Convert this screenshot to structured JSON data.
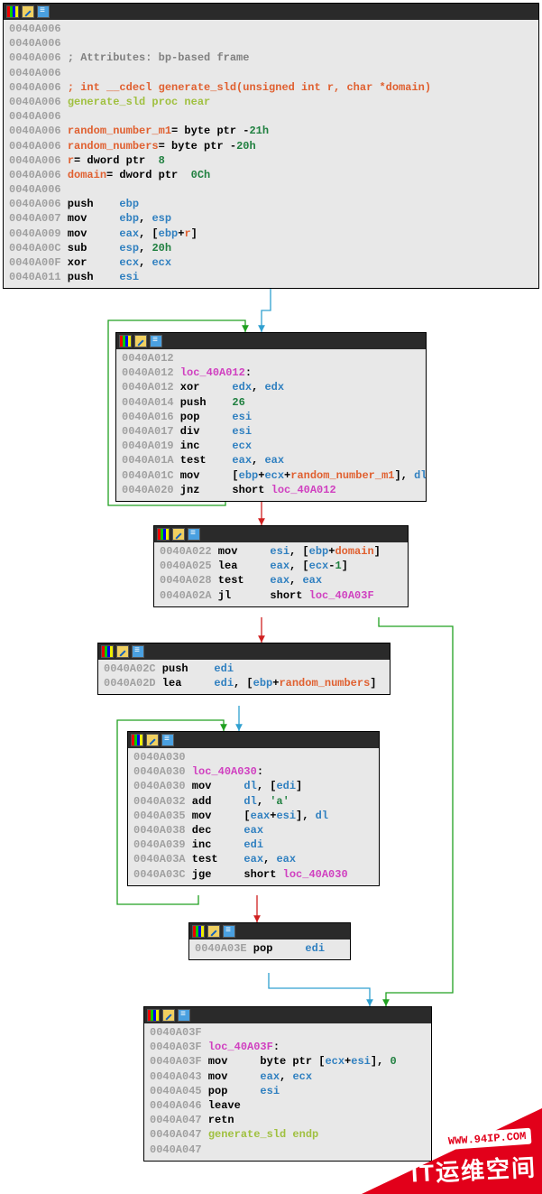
{
  "watermark": {
    "url": "WWW.94IP.COM",
    "text": "IT运维空间"
  },
  "blocks": {
    "b1": {
      "lines": [
        [
          [
            "addr",
            "0040A006"
          ]
        ],
        [
          [
            "addr",
            "0040A006"
          ]
        ],
        [
          [
            "addr",
            "0040A006"
          ],
          [
            "kw",
            " "
          ],
          [
            "comment",
            "; Attributes: bp-based frame"
          ]
        ],
        [
          [
            "addr",
            "0040A006"
          ]
        ],
        [
          [
            "addr",
            "0040A006"
          ],
          [
            "kw",
            " "
          ],
          [
            "sig",
            "; int __cdecl generate_sld(unsigned int r, char *domain)"
          ]
        ],
        [
          [
            "addr",
            "0040A006"
          ],
          [
            "kw",
            " "
          ],
          [
            "proc",
            "generate_sld proc near"
          ]
        ],
        [
          [
            "addr",
            "0040A006"
          ]
        ],
        [
          [
            "addr",
            "0040A006"
          ],
          [
            "kw",
            " "
          ],
          [
            "var",
            "random_number_m1"
          ],
          [
            "kw",
            "= byte ptr -"
          ],
          [
            "imm",
            "21h"
          ]
        ],
        [
          [
            "addr",
            "0040A006"
          ],
          [
            "kw",
            " "
          ],
          [
            "var",
            "random_numbers"
          ],
          [
            "kw",
            "= byte ptr -"
          ],
          [
            "imm",
            "20h"
          ]
        ],
        [
          [
            "addr",
            "0040A006"
          ],
          [
            "kw",
            " "
          ],
          [
            "var",
            "r"
          ],
          [
            "kw",
            "= dword ptr  "
          ],
          [
            "imm",
            "8"
          ]
        ],
        [
          [
            "addr",
            "0040A006"
          ],
          [
            "kw",
            " "
          ],
          [
            "var",
            "domain"
          ],
          [
            "kw",
            "= dword ptr  "
          ],
          [
            "imm",
            "0Ch"
          ]
        ],
        [
          [
            "addr",
            "0040A006"
          ]
        ],
        [
          [
            "addr",
            "0040A006"
          ],
          [
            "kw",
            " push    "
          ],
          [
            "reg",
            "ebp"
          ]
        ],
        [
          [
            "addr",
            "0040A007"
          ],
          [
            "kw",
            " mov     "
          ],
          [
            "reg",
            "ebp"
          ],
          [
            "kw",
            ", "
          ],
          [
            "reg",
            "esp"
          ]
        ],
        [
          [
            "addr",
            "0040A009"
          ],
          [
            "kw",
            " mov     "
          ],
          [
            "reg",
            "eax"
          ],
          [
            "kw",
            ", ["
          ],
          [
            "reg",
            "ebp"
          ],
          [
            "kw",
            "+"
          ],
          [
            "var",
            "r"
          ],
          [
            "kw",
            "]"
          ]
        ],
        [
          [
            "addr",
            "0040A00C"
          ],
          [
            "kw",
            " sub     "
          ],
          [
            "reg",
            "esp"
          ],
          [
            "kw",
            ", "
          ],
          [
            "imm",
            "20h"
          ]
        ],
        [
          [
            "addr",
            "0040A00F"
          ],
          [
            "kw",
            " xor     "
          ],
          [
            "reg",
            "ecx"
          ],
          [
            "kw",
            ", "
          ],
          [
            "reg",
            "ecx"
          ]
        ],
        [
          [
            "addr",
            "0040A011"
          ],
          [
            "kw",
            " push    "
          ],
          [
            "reg",
            "esi"
          ]
        ]
      ]
    },
    "b2": {
      "lines": [
        [
          [
            "addr",
            "0040A012"
          ]
        ],
        [
          [
            "addr",
            "0040A012"
          ],
          [
            "kw",
            " "
          ],
          [
            "loc",
            "loc_40A012"
          ],
          [
            "kw",
            ":"
          ]
        ],
        [
          [
            "addr",
            "0040A012"
          ],
          [
            "kw",
            " xor     "
          ],
          [
            "reg",
            "edx"
          ],
          [
            "kw",
            ", "
          ],
          [
            "reg",
            "edx"
          ]
        ],
        [
          [
            "addr",
            "0040A014"
          ],
          [
            "kw",
            " push    "
          ],
          [
            "imm",
            "26"
          ]
        ],
        [
          [
            "addr",
            "0040A016"
          ],
          [
            "kw",
            " pop     "
          ],
          [
            "reg",
            "esi"
          ]
        ],
        [
          [
            "addr",
            "0040A017"
          ],
          [
            "kw",
            " div     "
          ],
          [
            "reg",
            "esi"
          ]
        ],
        [
          [
            "addr",
            "0040A019"
          ],
          [
            "kw",
            " inc     "
          ],
          [
            "reg",
            "ecx"
          ]
        ],
        [
          [
            "addr",
            "0040A01A"
          ],
          [
            "kw",
            " test    "
          ],
          [
            "reg",
            "eax"
          ],
          [
            "kw",
            ", "
          ],
          [
            "reg",
            "eax"
          ]
        ],
        [
          [
            "addr",
            "0040A01C"
          ],
          [
            "kw",
            " mov     ["
          ],
          [
            "reg",
            "ebp"
          ],
          [
            "kw",
            "+"
          ],
          [
            "reg",
            "ecx"
          ],
          [
            "kw",
            "+"
          ],
          [
            "var",
            "random_number_m1"
          ],
          [
            "kw",
            "], "
          ],
          [
            "reg",
            "dl"
          ]
        ],
        [
          [
            "addr",
            "0040A020"
          ],
          [
            "kw",
            " jnz     short "
          ],
          [
            "loc",
            "loc_40A012"
          ]
        ]
      ]
    },
    "b3": {
      "lines": [
        [
          [
            "addr",
            "0040A022"
          ],
          [
            "kw",
            " mov     "
          ],
          [
            "reg",
            "esi"
          ],
          [
            "kw",
            ", ["
          ],
          [
            "reg",
            "ebp"
          ],
          [
            "kw",
            "+"
          ],
          [
            "var",
            "domain"
          ],
          [
            "kw",
            "]"
          ]
        ],
        [
          [
            "addr",
            "0040A025"
          ],
          [
            "kw",
            " lea     "
          ],
          [
            "reg",
            "eax"
          ],
          [
            "kw",
            ", ["
          ],
          [
            "reg",
            "ecx"
          ],
          [
            "kw",
            "-"
          ],
          [
            "imm",
            "1"
          ],
          [
            "kw",
            "]"
          ]
        ],
        [
          [
            "addr",
            "0040A028"
          ],
          [
            "kw",
            " test    "
          ],
          [
            "reg",
            "eax"
          ],
          [
            "kw",
            ", "
          ],
          [
            "reg",
            "eax"
          ]
        ],
        [
          [
            "addr",
            "0040A02A"
          ],
          [
            "kw",
            " jl      short "
          ],
          [
            "loc",
            "loc_40A03F"
          ]
        ]
      ]
    },
    "b4": {
      "lines": [
        [
          [
            "addr",
            "0040A02C"
          ],
          [
            "kw",
            " push    "
          ],
          [
            "reg",
            "edi"
          ]
        ],
        [
          [
            "addr",
            "0040A02D"
          ],
          [
            "kw",
            " lea     "
          ],
          [
            "reg",
            "edi"
          ],
          [
            "kw",
            ", ["
          ],
          [
            "reg",
            "ebp"
          ],
          [
            "kw",
            "+"
          ],
          [
            "var",
            "random_numbers"
          ],
          [
            "kw",
            "]"
          ]
        ]
      ]
    },
    "b5": {
      "lines": [
        [
          [
            "addr",
            "0040A030"
          ]
        ],
        [
          [
            "addr",
            "0040A030"
          ],
          [
            "kw",
            " "
          ],
          [
            "loc",
            "loc_40A030"
          ],
          [
            "kw",
            ":"
          ]
        ],
        [
          [
            "addr",
            "0040A030"
          ],
          [
            "kw",
            " mov     "
          ],
          [
            "reg",
            "dl"
          ],
          [
            "kw",
            ", ["
          ],
          [
            "reg",
            "edi"
          ],
          [
            "kw",
            "]"
          ]
        ],
        [
          [
            "addr",
            "0040A032"
          ],
          [
            "kw",
            " add     "
          ],
          [
            "reg",
            "dl"
          ],
          [
            "kw",
            ", "
          ],
          [
            "charlit",
            "'a'"
          ]
        ],
        [
          [
            "addr",
            "0040A035"
          ],
          [
            "kw",
            " mov     ["
          ],
          [
            "reg",
            "eax"
          ],
          [
            "kw",
            "+"
          ],
          [
            "reg",
            "esi"
          ],
          [
            "kw",
            "], "
          ],
          [
            "reg",
            "dl"
          ]
        ],
        [
          [
            "addr",
            "0040A038"
          ],
          [
            "kw",
            " dec     "
          ],
          [
            "reg",
            "eax"
          ]
        ],
        [
          [
            "addr",
            "0040A039"
          ],
          [
            "kw",
            " inc     "
          ],
          [
            "reg",
            "edi"
          ]
        ],
        [
          [
            "addr",
            "0040A03A"
          ],
          [
            "kw",
            " test    "
          ],
          [
            "reg",
            "eax"
          ],
          [
            "kw",
            ", "
          ],
          [
            "reg",
            "eax"
          ]
        ],
        [
          [
            "addr",
            "0040A03C"
          ],
          [
            "kw",
            " jge     short "
          ],
          [
            "loc",
            "loc_40A030"
          ]
        ]
      ]
    },
    "b6": {
      "lines": [
        [
          [
            "addr",
            "0040A03E"
          ],
          [
            "kw",
            " pop     "
          ],
          [
            "reg",
            "edi"
          ]
        ]
      ]
    },
    "b7": {
      "lines": [
        [
          [
            "addr",
            "0040A03F"
          ]
        ],
        [
          [
            "addr",
            "0040A03F"
          ],
          [
            "kw",
            " "
          ],
          [
            "loc",
            "loc_40A03F"
          ],
          [
            "kw",
            ":"
          ]
        ],
        [
          [
            "addr",
            "0040A03F"
          ],
          [
            "kw",
            " mov     byte ptr ["
          ],
          [
            "reg",
            "ecx"
          ],
          [
            "kw",
            "+"
          ],
          [
            "reg",
            "esi"
          ],
          [
            "kw",
            "], "
          ],
          [
            "imm",
            "0"
          ]
        ],
        [
          [
            "addr",
            "0040A043"
          ],
          [
            "kw",
            " mov     "
          ],
          [
            "reg",
            "eax"
          ],
          [
            "kw",
            ", "
          ],
          [
            "reg",
            "ecx"
          ]
        ],
        [
          [
            "addr",
            "0040A045"
          ],
          [
            "kw",
            " pop     "
          ],
          [
            "reg",
            "esi"
          ]
        ],
        [
          [
            "addr",
            "0040A046"
          ],
          [
            "kw",
            " leave"
          ]
        ],
        [
          [
            "addr",
            "0040A047"
          ],
          [
            "kw",
            " retn"
          ]
        ],
        [
          [
            "addr",
            "0040A047"
          ],
          [
            "kw",
            " "
          ],
          [
            "proc",
            "generate_sld endp"
          ]
        ],
        [
          [
            "addr",
            "0040A047"
          ]
        ]
      ]
    }
  }
}
